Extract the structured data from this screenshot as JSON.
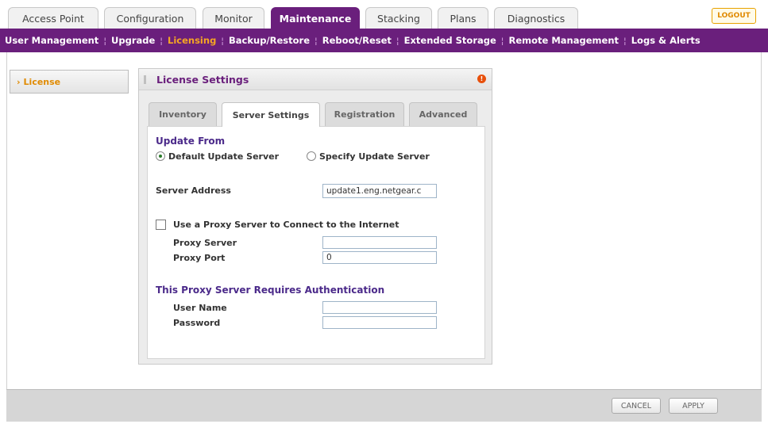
{
  "top_tabs": [
    {
      "label": "Access Point",
      "active": false
    },
    {
      "label": "Configuration",
      "active": false
    },
    {
      "label": "Monitor",
      "active": false
    },
    {
      "label": "Maintenance",
      "active": true
    },
    {
      "label": "Stacking",
      "active": false
    },
    {
      "label": "Plans",
      "active": false
    },
    {
      "label": "Diagnostics",
      "active": false
    }
  ],
  "logout_label": "LOGOUT",
  "sub_nav": [
    {
      "label": "User Management",
      "active": false
    },
    {
      "label": "Upgrade",
      "active": false
    },
    {
      "label": "Licensing",
      "active": true
    },
    {
      "label": "Backup/Restore",
      "active": false
    },
    {
      "label": "Reboot/Reset",
      "active": false
    },
    {
      "label": "Extended Storage",
      "active": false
    },
    {
      "label": "Remote Management",
      "active": false
    },
    {
      "label": "Logs & Alerts",
      "active": false
    }
  ],
  "sidebar": {
    "item_label": "License",
    "bullet": "›"
  },
  "panel": {
    "title": "License Settings",
    "help_icon": "!",
    "tabs": [
      {
        "label": "Inventory",
        "active": false
      },
      {
        "label": "Server Settings",
        "active": true
      },
      {
        "label": "Registration",
        "active": false
      },
      {
        "label": "Advanced",
        "active": false
      }
    ],
    "update_from": {
      "heading": "Update From",
      "option_default": "Default Update Server",
      "option_specify": "Specify Update Server",
      "selected": "default"
    },
    "server_address": {
      "label": "Server Address",
      "value": "update1.eng.netgear.c"
    },
    "proxy": {
      "checkbox_label": "Use a Proxy Server to Connect to the Internet",
      "checked": false,
      "server_label": "Proxy Server",
      "server_value": "",
      "port_label": "Proxy Port",
      "port_value": "0"
    },
    "auth": {
      "heading": "This Proxy Server Requires Authentication",
      "user_label": "User Name",
      "user_value": "",
      "password_label": "Password",
      "password_value": ""
    }
  },
  "footer": {
    "cancel_label": "CANCEL",
    "apply_label": "APPLY"
  },
  "colors": {
    "brand_purple": "#6a1f7c",
    "accent_orange": "#f5a623"
  }
}
